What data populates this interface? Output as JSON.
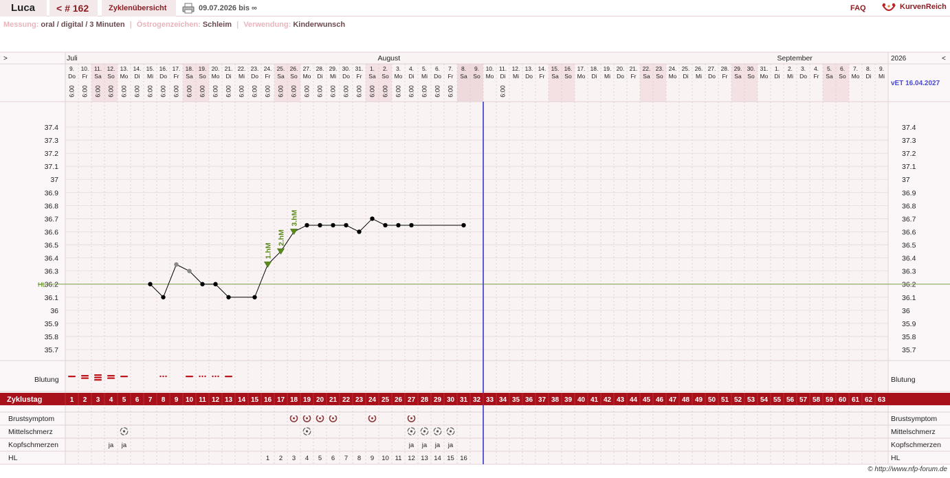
{
  "header": {
    "user": "Luca",
    "cycle": "< # 162",
    "overview_link": "Zyklenübersicht",
    "date_range": "09.07.2026 bis ∞",
    "faq": "FAQ",
    "brand": "KurvenReich"
  },
  "info": {
    "messung_label": "Messung:",
    "messung_value": "oral / digital / 3 Minuten",
    "oestrogen_label": "Östrogenzeichen:",
    "oestrogen_value": "Schleim",
    "verwendung_label": "Verwendung:",
    "verwendung_value": "Kinderwunsch"
  },
  "nav": {
    "prev": ">",
    "next": "<",
    "year": "2026",
    "vet": "vET 16.04.2027"
  },
  "months": [
    {
      "label": "Juli",
      "day_index": 0
    },
    {
      "label": "August",
      "day_index": 23
    },
    {
      "label": "September",
      "day_index": 54
    }
  ],
  "days": [
    [
      "9.",
      "Do"
    ],
    [
      "10.",
      "Fr"
    ],
    [
      "11.",
      "Sa"
    ],
    [
      "12.",
      "So"
    ],
    [
      "13.",
      "Mo"
    ],
    [
      "14.",
      "Di"
    ],
    [
      "15.",
      "Mi"
    ],
    [
      "16.",
      "Do"
    ],
    [
      "17.",
      "Fr"
    ],
    [
      "18.",
      "Sa"
    ],
    [
      "19.",
      "So"
    ],
    [
      "20.",
      "Mo"
    ],
    [
      "21.",
      "Di"
    ],
    [
      "22.",
      "Mi"
    ],
    [
      "23.",
      "Do"
    ],
    [
      "24.",
      "Fr"
    ],
    [
      "25.",
      "Sa"
    ],
    [
      "26.",
      "So"
    ],
    [
      "27.",
      "Mo"
    ],
    [
      "28.",
      "Di"
    ],
    [
      "29.",
      "Mi"
    ],
    [
      "30.",
      "Do"
    ],
    [
      "31.",
      "Fr"
    ],
    [
      "1.",
      "Sa"
    ],
    [
      "2.",
      "So"
    ],
    [
      "3.",
      "Mo"
    ],
    [
      "4.",
      "Di"
    ],
    [
      "5.",
      "Mi"
    ],
    [
      "6.",
      "Do"
    ],
    [
      "7.",
      "Fr"
    ],
    [
      "8.",
      "Sa"
    ],
    [
      "9.",
      "So"
    ],
    [
      "10.",
      "Mo"
    ],
    [
      "11.",
      "Di"
    ],
    [
      "12.",
      "Mi"
    ],
    [
      "13.",
      "Do"
    ],
    [
      "14.",
      "Fr"
    ],
    [
      "15.",
      "Sa"
    ],
    [
      "16.",
      "So"
    ],
    [
      "17.",
      "Mo"
    ],
    [
      "18.",
      "Di"
    ],
    [
      "19.",
      "Mi"
    ],
    [
      "20.",
      "Do"
    ],
    [
      "21.",
      "Fr"
    ],
    [
      "22.",
      "Sa"
    ],
    [
      "23.",
      "So"
    ],
    [
      "24.",
      "Mo"
    ],
    [
      "25.",
      "Di"
    ],
    [
      "26.",
      "Mi"
    ],
    [
      "27.",
      "Do"
    ],
    [
      "28.",
      "Fr"
    ],
    [
      "29.",
      "Sa"
    ],
    [
      "30.",
      "So"
    ],
    [
      "31.",
      "Mo"
    ],
    [
      "1.",
      "Di"
    ],
    [
      "2.",
      "Mi"
    ],
    [
      "3.",
      "Do"
    ],
    [
      "4.",
      "Fr"
    ],
    [
      "5.",
      "Sa"
    ],
    [
      "6.",
      "So"
    ],
    [
      "7.",
      "Mo"
    ],
    [
      "8.",
      "Di"
    ],
    [
      "9.",
      "Mi"
    ]
  ],
  "times": [
    "6:00",
    "6:00",
    "6:00",
    "6:00",
    "6:00",
    "6:00",
    "6:00",
    "6:00",
    "6:00",
    "6:00",
    "6:00",
    "6:00",
    "6:00",
    "6:00",
    "6:00",
    "6:00",
    "6:00",
    "6:00",
    "6:00",
    "6:00",
    "6:00",
    "6:00",
    "6:00",
    "6:00",
    "6:00",
    "6:00",
    "6:00",
    "6:00",
    "6:00",
    "6:00",
    null,
    null,
    null,
    "6:00",
    null,
    null,
    null,
    null,
    null,
    null,
    null,
    null,
    null,
    null,
    null,
    null,
    null,
    null,
    null,
    null,
    null,
    null,
    null,
    null,
    null,
    null,
    null,
    null,
    null,
    null,
    null,
    null,
    null
  ],
  "future_shaded_days": [
    30,
    31
  ],
  "current_day_divider_after": 31,
  "chart_data": {
    "type": "line",
    "y_ticks": [
      "37.4",
      "37.3",
      "37.2",
      "37.1",
      "37",
      "36.9",
      "36.8",
      "36.7",
      "36.6",
      "36.5",
      "36.4",
      "36.3",
      "36.2",
      "36.1",
      "36",
      "35.9",
      "35.8",
      "35.7"
    ],
    "ylim": [
      35.7,
      37.4
    ],
    "coverline": {
      "label": "HL",
      "value": 36.2
    },
    "series": [
      {
        "name": "",
        "points": [
          {
            "day": 6,
            "temp": 36.2
          },
          {
            "day": 7,
            "temp": 36.1
          },
          {
            "day": 8,
            "temp": 36.35,
            "excluded": true
          },
          {
            "day": 9,
            "temp": 36.3,
            "excluded": true
          },
          {
            "day": 10,
            "temp": 36.2
          },
          {
            "day": 11,
            "temp": 36.2
          },
          {
            "day": 12,
            "temp": 36.1
          },
          {
            "day": 14,
            "temp": 36.1
          },
          {
            "day": 15,
            "temp": 36.35,
            "marker": "1.hM"
          },
          {
            "day": 16,
            "temp": 36.45,
            "marker": "2.hM"
          },
          {
            "day": 17,
            "temp": 36.6,
            "marker": "3.hM"
          },
          {
            "day": 18,
            "temp": 36.65
          },
          {
            "day": 19,
            "temp": 36.65
          },
          {
            "day": 20,
            "temp": 36.65
          },
          {
            "day": 21,
            "temp": 36.65
          },
          {
            "day": 22,
            "temp": 36.6
          },
          {
            "day": 23,
            "temp": 36.7
          },
          {
            "day": 24,
            "temp": 36.65
          },
          {
            "day": 25,
            "temp": 36.65
          },
          {
            "day": 26,
            "temp": 36.65
          },
          {
            "day": 30,
            "temp": 36.65
          }
        ]
      }
    ]
  },
  "rows": {
    "blutung": {
      "label": "Blutung",
      "values": [
        "mittel",
        "stark",
        "sehr stark",
        "stark",
        "mittel",
        null,
        null,
        "schmier",
        null,
        "mittel",
        "schmier",
        "schmier",
        "mittel"
      ]
    },
    "zyklustag": {
      "label": "Zyklustag",
      "count": 63
    },
    "brust": {
      "label": "Brustsymptom",
      "days": [
        17,
        18,
        19,
        20,
        23,
        26
      ]
    },
    "mittel": {
      "label": "Mittelschmerz",
      "days": [
        4,
        18,
        26,
        27,
        28,
        29
      ]
    },
    "kopf": {
      "label": "Kopfschmerzen",
      "values": {
        "3": "ja",
        "4": "ja",
        "26": "ja",
        "27": "ja",
        "28": "ja",
        "29": "ja"
      }
    },
    "hl": {
      "label": "HL",
      "values": {
        "15": "1",
        "16": "2",
        "17": "3",
        "18": "4",
        "19": "5",
        "20": "6",
        "21": "7",
        "22": "8",
        "23": "9",
        "24": "10",
        "25": "11",
        "26": "12",
        "27": "13",
        "28": "14",
        "29": "15",
        "30": "16"
      }
    }
  },
  "copyright": "© http://www.nfp-forum.de",
  "colors": {
    "accent": "#8c1d23",
    "line": "#000000",
    "excluded": "#888888",
    "marker": "#5a8a1a",
    "today": "#4a4ad0",
    "coverline": "#7aa04a",
    "weekend": "#f3e1e3"
  }
}
